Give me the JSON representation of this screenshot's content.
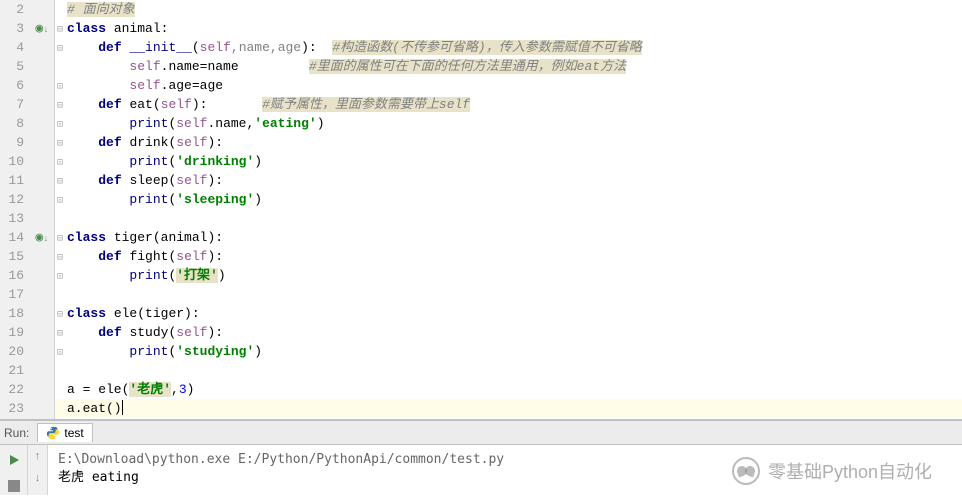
{
  "lines": [
    {
      "n": 2,
      "marker": "",
      "fold": "",
      "html": "<span class='comment-hl'># 面向对象</span>"
    },
    {
      "n": 3,
      "marker": "●↓",
      "fold": "⊟",
      "html": "<span class='kw'>class</span> <span class='fn'>animal</span>:"
    },
    {
      "n": 4,
      "marker": "",
      "fold": "⊟",
      "html": "    <span class='kw'>def</span> <span class='builtin'>__init__</span>(<span class='self'>self</span><span class='param'>,name,age</span>):  <span class='comment-hl'>#构造函数(不传参可省略)，传入参数需赋值不可省略</span>"
    },
    {
      "n": 5,
      "marker": "",
      "fold": "",
      "html": "        <span class='self'>self</span>.name=name         <span class='comment-hl'>#里面的属性可在下面的任何方法里通用，例如eat方法</span>"
    },
    {
      "n": 6,
      "marker": "",
      "fold": "⊡",
      "html": "        <span class='self'>self</span>.age=age"
    },
    {
      "n": 7,
      "marker": "",
      "fold": "⊟",
      "html": "    <span class='kw'>def</span> <span class='fn'>eat</span>(<span class='self'>self</span>):       <span class='comment-hl'>#赋予属性，里面参数需要带上self</span>"
    },
    {
      "n": 8,
      "marker": "",
      "fold": "⊡",
      "html": "        <span class='builtin'>print</span>(<span class='self'>self</span>.name,<span class='str'>'eating'</span>)"
    },
    {
      "n": 9,
      "marker": "",
      "fold": "⊟",
      "html": "    <span class='kw'>def</span> <span class='fn'>drink</span>(<span class='self'>self</span>):"
    },
    {
      "n": 10,
      "marker": "",
      "fold": "⊡",
      "html": "        <span class='builtin'>print</span>(<span class='str'>'drinking'</span>)"
    },
    {
      "n": 11,
      "marker": "",
      "fold": "⊟",
      "html": "    <span class='kw'>def</span> <span class='fn'>sleep</span>(<span class='self'>self</span>):"
    },
    {
      "n": 12,
      "marker": "",
      "fold": "⊡",
      "html": "        <span class='builtin'>print</span>(<span class='str'>'sleeping'</span>)"
    },
    {
      "n": 13,
      "marker": "",
      "fold": "",
      "html": ""
    },
    {
      "n": 14,
      "marker": "●↓",
      "fold": "⊟",
      "html": "<span class='kw'>class</span> <span class='fn'>tiger</span>(animal):"
    },
    {
      "n": 15,
      "marker": "",
      "fold": "⊟",
      "html": "    <span class='kw'>def</span> <span class='fn'>fight</span>(<span class='self'>self</span>):"
    },
    {
      "n": 16,
      "marker": "",
      "fold": "⊡",
      "html": "        <span class='builtin'>print</span>(<span class='str-hl'>'打架'</span>)"
    },
    {
      "n": 17,
      "marker": "",
      "fold": "",
      "html": ""
    },
    {
      "n": 18,
      "marker": "",
      "fold": "⊟",
      "html": "<span class='kw'>class</span> <span class='fn'>ele</span>(tiger):"
    },
    {
      "n": 19,
      "marker": "",
      "fold": "⊟",
      "html": "    <span class='kw'>def</span> <span class='fn'>study</span>(<span class='self'>self</span>):"
    },
    {
      "n": 20,
      "marker": "",
      "fold": "⊡",
      "html": "        <span class='builtin'>print</span>(<span class='str'>'studying'</span>)"
    },
    {
      "n": 21,
      "marker": "",
      "fold": "",
      "html": ""
    },
    {
      "n": 22,
      "marker": "",
      "fold": "",
      "html": "a = ele(<span class='str-hl'>'老虎'</span>,<span class='num'>3</span>)"
    },
    {
      "n": 23,
      "marker": "",
      "fold": "",
      "html": "a.eat()<span class='caret'></span>",
      "current": true
    }
  ],
  "run": {
    "label": "Run:",
    "tab": "test",
    "cmd": "E:\\Download\\python.exe E:/Python/PythonApi/common/test.py",
    "output": "老虎 eating"
  },
  "watermark": "零基础Python自动化"
}
